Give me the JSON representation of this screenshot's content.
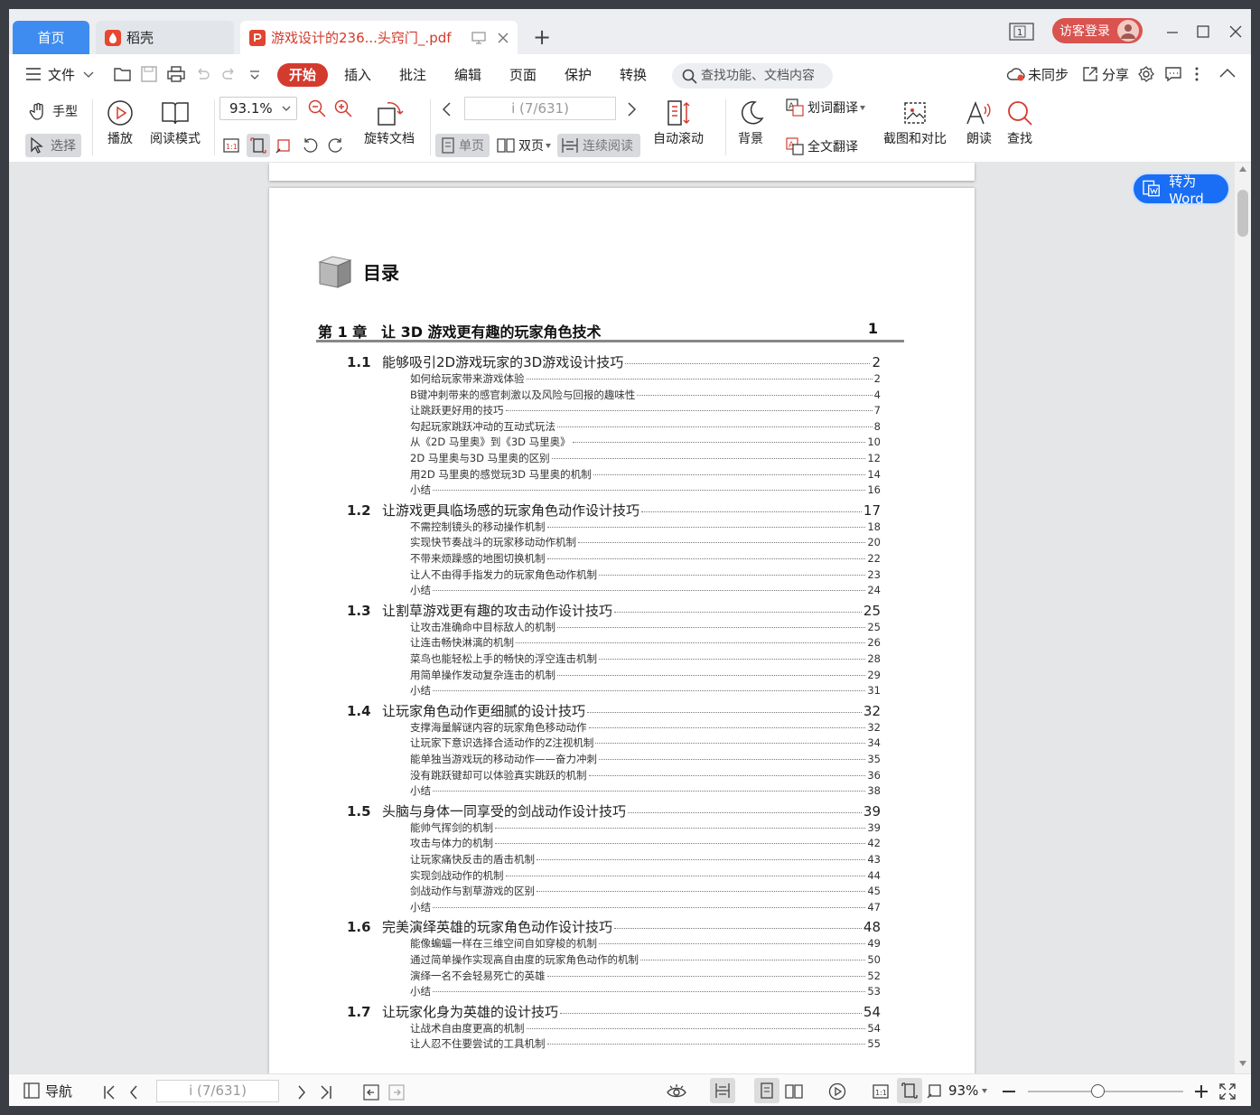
{
  "tabs": {
    "home": "首页",
    "daoke": "稻壳",
    "doc": "游戏设计的236...头窍门_.pdf"
  },
  "header": {
    "page_badge": "1",
    "login": "访客登录"
  },
  "menu": {
    "file": "文件",
    "items": [
      "开始",
      "插入",
      "批注",
      "编辑",
      "页面",
      "保护",
      "转换"
    ],
    "search_placeholder": "查找功能、文档内容",
    "sync": "未同步",
    "share": "分享"
  },
  "toolbar": {
    "hand": "手型",
    "select": "选择",
    "play": "播放",
    "read_mode": "阅读模式",
    "zoom": "93.1%",
    "rotate": "旋转文档",
    "page_input": "i (7/631)",
    "single": "单页",
    "double": "双页",
    "continuous": "连续阅读",
    "autoscroll": "自动滚动",
    "background": "背景",
    "word_translate": "划词翻译",
    "full_translate": "全文翻译",
    "screenshot": "截图和对比",
    "read_aloud": "朗读",
    "find": "查找"
  },
  "convert_word": "转为Word",
  "doc": {
    "toc_title": "目录",
    "chapter": {
      "label": "第 1 章",
      "title": "让 3D 游戏更有趣的玩家角色技术",
      "page": "1"
    },
    "sections": [
      {
        "num": "1.1",
        "title": "能够吸引2D游戏玩家的3D游戏设计技巧",
        "page": "2",
        "items": [
          [
            "如何给玩家带来游戏体验",
            "2"
          ],
          [
            "B键冲刺带来的感官刺激以及风险与回报的趣味性",
            "4"
          ],
          [
            "让跳跃更好用的技巧",
            "7"
          ],
          [
            "勾起玩家跳跃冲动的互动式玩法",
            "8"
          ],
          [
            "从《2D 马里奥》到《3D 马里奥》",
            "10"
          ],
          [
            "2D 马里奥与3D 马里奥的区别",
            "12"
          ],
          [
            "用2D 马里奥的感觉玩3D 马里奥的机制",
            "14"
          ],
          [
            "小结",
            "16"
          ]
        ]
      },
      {
        "num": "1.2",
        "title": "让游戏更具临场感的玩家角色动作设计技巧",
        "page": "17",
        "items": [
          [
            "不需控制镜头的移动操作机制",
            "18"
          ],
          [
            "实现快节奏战斗的玩家移动动作机制",
            "20"
          ],
          [
            "不带来烦躁感的地图切换机制",
            "22"
          ],
          [
            "让人不由得手指发力的玩家角色动作机制",
            "23"
          ],
          [
            "小结",
            "24"
          ]
        ]
      },
      {
        "num": "1.3",
        "title": "让割草游戏更有趣的攻击动作设计技巧",
        "page": "25",
        "items": [
          [
            "让攻击准确命中目标敌人的机制",
            "25"
          ],
          [
            "让连击畅快淋漓的机制",
            "26"
          ],
          [
            "菜鸟也能轻松上手的畅快的浮空连击机制",
            "28"
          ],
          [
            "用简单操作发动复杂连击的机制",
            "29"
          ],
          [
            "小结",
            "31"
          ]
        ]
      },
      {
        "num": "1.4",
        "title": "让玩家角色动作更细腻的设计技巧",
        "page": "32",
        "items": [
          [
            "支撑海量解谜内容的玩家角色移动动作",
            "32"
          ],
          [
            "让玩家下意识选择合适动作的Z注视机制",
            "34"
          ],
          [
            "能单独当游戏玩的移动动作——奋力冲刺",
            "35"
          ],
          [
            "没有跳跃键却可以体验真实跳跃的机制",
            "36"
          ],
          [
            "小结",
            "38"
          ]
        ]
      },
      {
        "num": "1.5",
        "title": "头脑与身体一同享受的剑战动作设计技巧",
        "page": "39",
        "items": [
          [
            "能帅气挥剑的机制",
            "39"
          ],
          [
            "攻击与体力的机制",
            "42"
          ],
          [
            "让玩家痛快反击的盾击机制",
            "43"
          ],
          [
            "实现剑战动作的机制",
            "44"
          ],
          [
            "剑战动作与割草游戏的区别",
            "45"
          ],
          [
            "小结",
            "47"
          ]
        ]
      },
      {
        "num": "1.6",
        "title": "完美演绎英雄的玩家角色动作设计技巧",
        "page": "48",
        "items": [
          [
            "能像蝙蝠一样在三维空间自如穿梭的机制",
            "49"
          ],
          [
            "通过简单操作实现高自由度的玩家角色动作的机制",
            "50"
          ],
          [
            "演绎一名不会轻易死亡的英雄",
            "52"
          ],
          [
            "小结",
            "53"
          ]
        ]
      },
      {
        "num": "1.7",
        "title": "让玩家化身为英雄的设计技巧",
        "page": "54",
        "items": [
          [
            "让战术自由度更高的机制",
            "54"
          ],
          [
            "让人忍不住要尝试的工具机制",
            "55"
          ]
        ]
      }
    ]
  },
  "status": {
    "nav": "导航",
    "page_input": "i (7/631)",
    "zoom": "93%"
  }
}
